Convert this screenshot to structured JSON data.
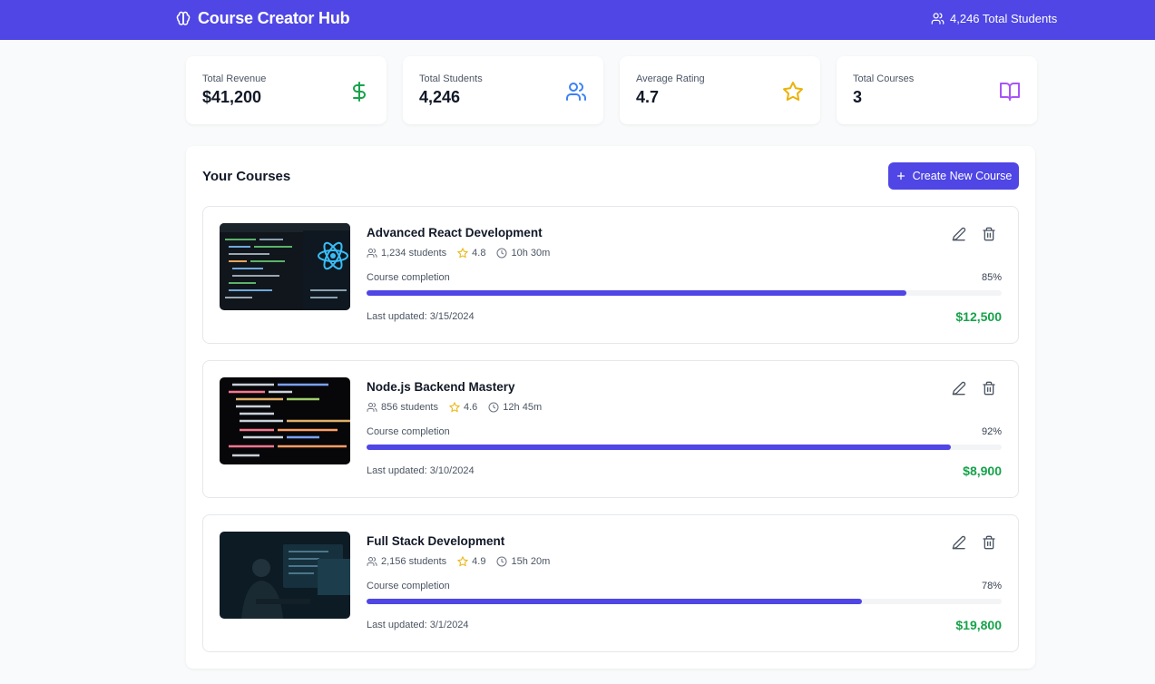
{
  "header": {
    "brand": "Course Creator Hub",
    "students_summary": "4,246 Total Students"
  },
  "stats": [
    {
      "label": "Total Revenue",
      "value": "$41,200",
      "icon": "dollar-icon",
      "color": "#16a34a"
    },
    {
      "label": "Total Students",
      "value": "4,246",
      "icon": "users-icon",
      "color": "#3b82f6"
    },
    {
      "label": "Average Rating",
      "value": "4.7",
      "icon": "star-icon",
      "color": "#eab308"
    },
    {
      "label": "Total Courses",
      "value": "3",
      "icon": "book-icon",
      "color": "#a855f7"
    }
  ],
  "courses_panel": {
    "title": "Your Courses",
    "create_label": "Create New Course"
  },
  "completion_label": "Course completion",
  "courses": [
    {
      "title": "Advanced React Development",
      "students": "1,234 students",
      "rating": "4.8",
      "duration": "10h 30m",
      "completion": "85%",
      "completion_value": 0.85,
      "updated": "Last updated: 3/15/2024",
      "revenue": "$12,500"
    },
    {
      "title": "Node.js Backend Mastery",
      "students": "856 students",
      "rating": "4.6",
      "duration": "12h 45m",
      "completion": "92%",
      "completion_value": 0.92,
      "updated": "Last updated: 3/10/2024",
      "revenue": "$8,900"
    },
    {
      "title": "Full Stack Development",
      "students": "2,156 students",
      "rating": "4.9",
      "duration": "15h 20m",
      "completion": "78%",
      "completion_value": 0.78,
      "updated": "Last updated: 3/1/2024",
      "revenue": "$19,800"
    }
  ],
  "colors": {
    "accent": "#4f46e5",
    "success": "#16a34a",
    "star": "#eab308"
  }
}
